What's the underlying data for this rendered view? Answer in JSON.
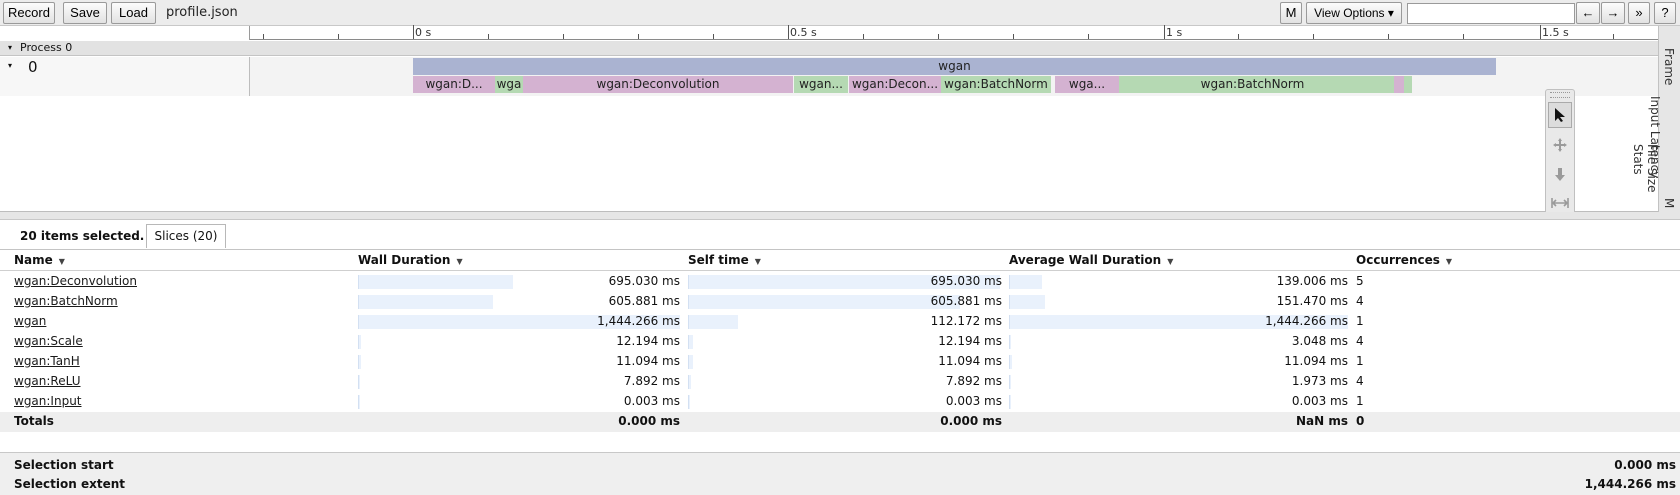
{
  "toolbar": {
    "record_label": "Record",
    "save_label": "Save",
    "load_label": "Load",
    "filename": "profile.json",
    "m_label": "M",
    "view_options_label": "View Options ▾",
    "search_value": "",
    "prev_label": "←",
    "next_label": "→",
    "more_label": "»",
    "help_label": "?"
  },
  "timeline": {
    "ruler_labels": [
      "0 s",
      "0.5 s",
      "1 s",
      "1.5 s"
    ],
    "process_label": "Process 0",
    "thread_label": "0",
    "slices_top": [
      {
        "label": "wgan",
        "color": "#aab3d1"
      }
    ],
    "slices_bottom": [
      {
        "label": "wgan:D...",
        "color": "#d4b2d1"
      },
      {
        "label": "wga",
        "color": "#b5d9b3"
      },
      {
        "label": "wgan:Deconvolution",
        "color": "#d4b2d1"
      },
      {
        "label": "wgan...",
        "color": "#b5d9b3"
      },
      {
        "label": "wgan:Decon...",
        "color": "#d4b2d1"
      },
      {
        "label": "wgan:BatchNorm",
        "color": "#b5d9b3"
      },
      {
        "label": "wga...",
        "color": "#d4b2d1"
      },
      {
        "label": "wgan:BatchNorm",
        "color": "#b5d9b3"
      },
      {
        "label": "",
        "color": "#b5d9b3"
      },
      {
        "label": "",
        "color": "#d4b2d1"
      },
      {
        "label": "",
        "color": "#b5d9b3"
      }
    ]
  },
  "side_tabs": [
    "Frame",
    "Input Latency",
    "File Size Stats",
    "M"
  ],
  "tools": [
    "select-tool",
    "pan-tool",
    "zoom-tool",
    "timing-tool"
  ],
  "analysis": {
    "selection_count": "20 items selected.",
    "tab_label": "Slices (20)",
    "columns": {
      "name": "Name",
      "wall": "Wall Duration",
      "self": "Self time",
      "avg": "Average Wall Duration",
      "occ": "Occurrences"
    },
    "rows": [
      {
        "name": "wgan:Deconvolution",
        "wall": "695.030 ms",
        "self": "695.030 ms",
        "avg": "139.006 ms",
        "occ": "5",
        "wall_frac": 0.481,
        "self_frac": 0.994,
        "avg_frac": 0.096
      },
      {
        "name": "wgan:BatchNorm",
        "wall": "605.881 ms",
        "self": "605.881 ms",
        "avg": "151.470 ms",
        "occ": "4",
        "wall_frac": 0.419,
        "self_frac": 0.866,
        "avg_frac": 0.105
      },
      {
        "name": "wgan",
        "wall": "1,444.266 ms",
        "self": "112.172 ms",
        "avg": "1,444.266 ms",
        "occ": "1",
        "wall_frac": 1.0,
        "self_frac": 0.16,
        "avg_frac": 1.0
      },
      {
        "name": "wgan:Scale",
        "wall": "12.194 ms",
        "self": "12.194 ms",
        "avg": "3.048 ms",
        "occ": "4",
        "wall_frac": 0.008,
        "self_frac": 0.017,
        "avg_frac": 0.002
      },
      {
        "name": "wgan:TanH",
        "wall": "11.094 ms",
        "self": "11.094 ms",
        "avg": "11.094 ms",
        "occ": "1",
        "wall_frac": 0.008,
        "self_frac": 0.016,
        "avg_frac": 0.008
      },
      {
        "name": "wgan:ReLU",
        "wall": "7.892 ms",
        "self": "7.892 ms",
        "avg": "1.973 ms",
        "occ": "4",
        "wall_frac": 0.005,
        "self_frac": 0.011,
        "avg_frac": 0.001
      },
      {
        "name": "wgan:Input",
        "wall": "0.003 ms",
        "self": "0.003 ms",
        "avg": "0.003 ms",
        "occ": "1",
        "wall_frac": 0.0,
        "self_frac": 0.0,
        "avg_frac": 0.0
      }
    ],
    "totals": {
      "label": "Totals",
      "wall": "0.000 ms",
      "self": "0.000 ms",
      "avg": "NaN ms",
      "occ": "0"
    }
  },
  "summary": {
    "start_label": "Selection start",
    "start_value": "0.000 ms",
    "extent_label": "Selection extent",
    "extent_value": "1,444.266 ms"
  }
}
